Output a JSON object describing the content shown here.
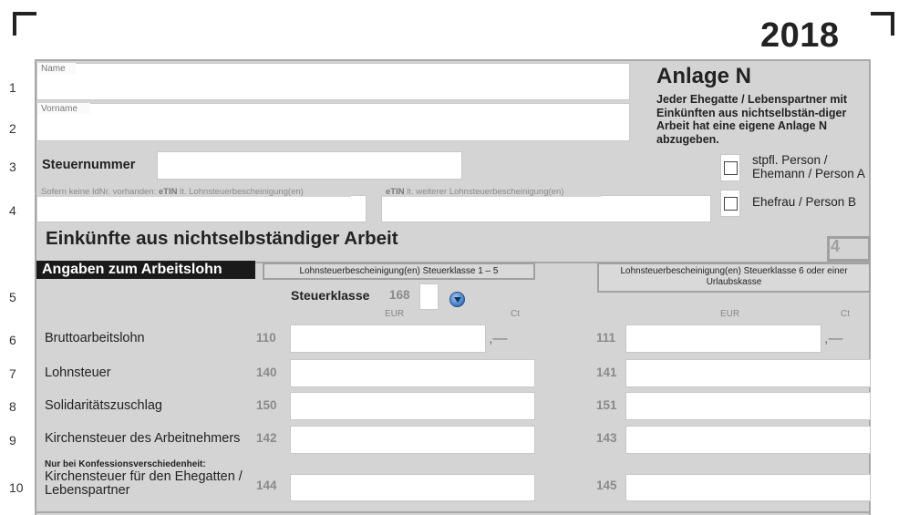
{
  "header": {
    "year": "2018"
  },
  "row_numbers": [
    "1",
    "2",
    "3",
    "4",
    "5",
    "6",
    "7",
    "8",
    "9",
    "10"
  ],
  "personal": {
    "name_label": "Name",
    "vorname_label": "Vorname",
    "steuernummer_label": "Steuernummer",
    "etin_label_prefix": "Sofern keine IdNr. vorhanden: ",
    "etin_label_bold": "eTIN",
    "etin_label_suffix": " lt. Lohnsteuerbescheinigung(en)",
    "etin2_label_bold": "eTIN",
    "etin2_label_suffix": " lt. weiterer Lohnsteuerbescheinigung(en)"
  },
  "anlage": {
    "title": "Anlage N",
    "description": "Jeder Ehegatte / Lebenspartner mit Einkünften aus nichtselbstän-diger Arbeit hat eine eigene Anlage N abzugeben.",
    "checkbox_a_label": "stpfl. Person / Ehemann / Person A",
    "checkbox_b_label": "Ehefrau / Person B"
  },
  "section": {
    "heading": "Einkünfte aus nichtselbständiger Arbeit",
    "page_number": "4",
    "subheading": "Angaben zum Arbeitslohn",
    "tab_left": "Lohnsteuerbescheinigung(en) Steuerklasse 1 – 5",
    "tab_right": "Lohnsteuerbescheinigung(en) Steuerklasse 6 oder einer Urlaubskasse"
  },
  "steuerklasse": {
    "label": "Steuerklasse",
    "code": "168"
  },
  "units": {
    "eur": "EUR",
    "ct": "Ct",
    "dash": ",—"
  },
  "rows": [
    {
      "label": "Bruttoarbeitslohn",
      "code_left": "110",
      "code_right": "111"
    },
    {
      "label": "Lohnsteuer",
      "code_left": "140",
      "code_right": "141"
    },
    {
      "label": "Solidaritätszuschlag",
      "code_left": "150",
      "code_right": "151"
    },
    {
      "label": "Kirchensteuer des Arbeitnehmers",
      "code_left": "142",
      "code_right": "143"
    }
  ],
  "row10": {
    "note": "Nur bei Konfessionsverschiedenheit:",
    "label": "Kirchensteuer für den Ehegatten / Lebenspartner",
    "code_left": "144",
    "code_right": "145"
  }
}
